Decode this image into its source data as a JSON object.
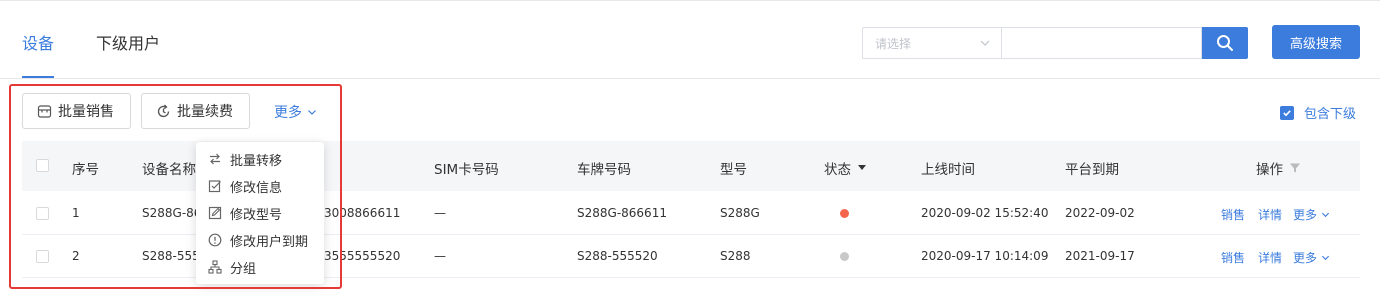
{
  "tabs": [
    {
      "label": "设备",
      "active": true
    },
    {
      "label": "下级用户",
      "active": false
    }
  ],
  "search": {
    "select_placeholder": "请选择",
    "input_value": "",
    "advanced_label": "高级搜索"
  },
  "toolbar": {
    "batch_sell": "批量销售",
    "batch_renew": "批量续费",
    "more": "更多",
    "include_sub": "包含下级",
    "include_sub_checked": true
  },
  "dropdown": {
    "items": [
      {
        "label": "批量转移",
        "icon": "transfer-icon"
      },
      {
        "label": "修改信息",
        "icon": "edit-info-icon"
      },
      {
        "label": "修改型号",
        "icon": "edit-model-icon"
      },
      {
        "label": "修改用户到期",
        "icon": "alert-circle-icon"
      },
      {
        "label": "分组",
        "icon": "group-icon"
      }
    ]
  },
  "table": {
    "headers": {
      "index": "序号",
      "name": "设备名称",
      "sim": "SIM卡号码",
      "plate": "车牌号码",
      "model": "型号",
      "status": "状态",
      "online": "上线时间",
      "expire": "平台到期",
      "ops": "操作"
    },
    "rows": [
      {
        "index": "1",
        "name_visible": "S288G-86",
        "imei_visible": "3008866611",
        "sim": "—",
        "plate": "S288G-866611",
        "model": "S288G",
        "status_color": "#f4664a",
        "online": "2020-09-02 15:52:40",
        "expire": "2022-09-02"
      },
      {
        "index": "2",
        "name_visible": "S288-555",
        "imei_visible": "3555555520",
        "sim": "—",
        "plate": "S288-555520",
        "model": "S288",
        "status_color": "#c8c8c8",
        "online": "2020-09-17 10:14:09",
        "expire": "2021-09-17"
      }
    ],
    "row_actions": {
      "sell": "销售",
      "detail": "详情",
      "more": "更多"
    }
  },
  "colors": {
    "accent": "#3b7cdd",
    "highlight": "#e53935"
  }
}
